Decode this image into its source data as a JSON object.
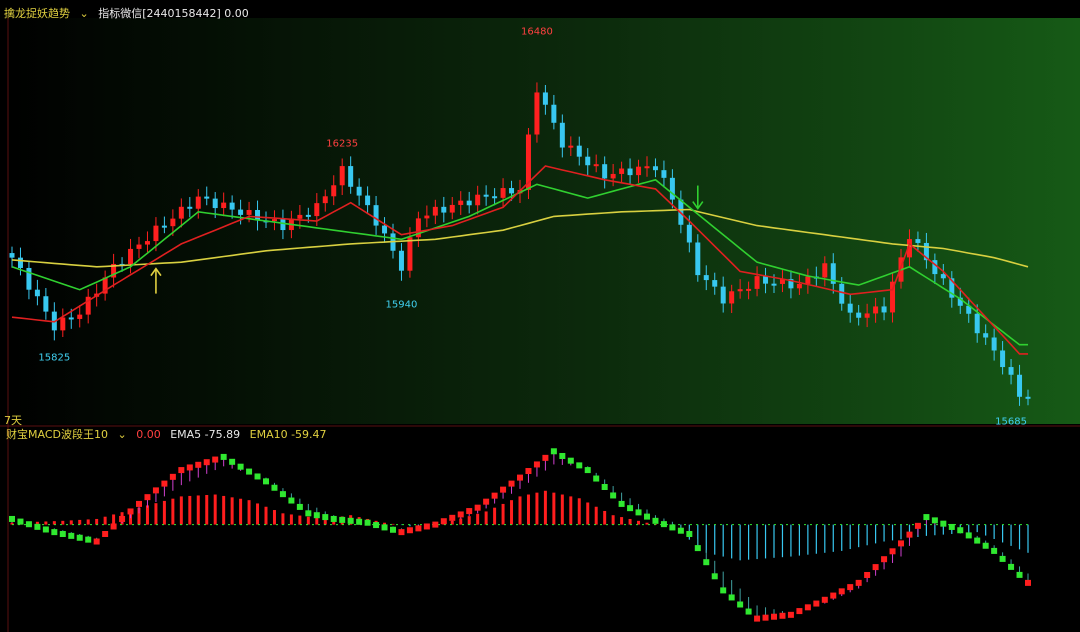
{
  "top_header": {
    "indicator_name": "擒龙捉妖趋势",
    "params_label": "指标微信[2440158442] 0.00"
  },
  "bottom_header": {
    "period_label": "7天",
    "indicator_name": "财宝MACD波段王10",
    "value_label": "0.00",
    "ema5_label": "EMA5 -75.89",
    "ema10_label": "EMA10 -59.47"
  },
  "colors": {
    "up": "#ff2020",
    "down": "#38c8f0",
    "ema_fast": "#e02020",
    "ema_mid": "#30d030",
    "ema_slow": "#d8d040",
    "macd_red": "#ff1e1e",
    "macd_green": "#30e830",
    "text_yellow": "#e0d040",
    "text_red": "#ff4040",
    "text_cyan": "#40d0f0"
  },
  "chart_data": [
    {
      "type": "candlestick",
      "title": "",
      "y_range": [
        15660,
        16520
      ],
      "annotations": [
        {
          "text": "16480",
          "index": 62,
          "value": 16480,
          "color": "red"
        },
        {
          "text": "16235",
          "index": 39,
          "value": 16235,
          "color": "red"
        },
        {
          "text": "15940",
          "index": 46,
          "value": 15940,
          "color": "cyan"
        },
        {
          "text": "15825",
          "index": 5,
          "value": 15825,
          "color": "cyan"
        },
        {
          "text": "15685",
          "index": 118,
          "value": 15685,
          "color": "cyan"
        }
      ],
      "arrows": [
        {
          "index": 17,
          "direction": "up",
          "color": "yellow"
        },
        {
          "index": 81,
          "direction": "down",
          "color": "green"
        }
      ],
      "candle_close_path": [
        [
          0,
          16010
        ],
        [
          5,
          15860
        ],
        [
          8,
          15890
        ],
        [
          12,
          15990
        ],
        [
          17,
          16070
        ],
        [
          22,
          16140
        ],
        [
          27,
          16110
        ],
        [
          32,
          16080
        ],
        [
          36,
          16120
        ],
        [
          39,
          16200
        ],
        [
          43,
          16090
        ],
        [
          46,
          15990
        ],
        [
          48,
          16100
        ],
        [
          55,
          16140
        ],
        [
          60,
          16160
        ],
        [
          62,
          16380
        ],
        [
          65,
          16260
        ],
        [
          70,
          16190
        ],
        [
          76,
          16210
        ],
        [
          78,
          16140
        ],
        [
          81,
          15980
        ],
        [
          84,
          15920
        ],
        [
          88,
          15960
        ],
        [
          93,
          15950
        ],
        [
          96,
          15990
        ],
        [
          99,
          15880
        ],
        [
          103,
          15900
        ],
        [
          106,
          16060
        ],
        [
          109,
          15980
        ],
        [
          113,
          15880
        ],
        [
          117,
          15780
        ],
        [
          119,
          15710
        ]
      ],
      "ema_fast_path": [
        [
          0,
          15880
        ],
        [
          5,
          15870
        ],
        [
          12,
          15950
        ],
        [
          20,
          16040
        ],
        [
          28,
          16100
        ],
        [
          36,
          16090
        ],
        [
          40,
          16130
        ],
        [
          46,
          16060
        ],
        [
          52,
          16080
        ],
        [
          58,
          16120
        ],
        [
          63,
          16210
        ],
        [
          70,
          16180
        ],
        [
          76,
          16160
        ],
        [
          80,
          16090
        ],
        [
          86,
          15980
        ],
        [
          92,
          15960
        ],
        [
          99,
          15930
        ],
        [
          104,
          15940
        ],
        [
          106,
          16040
        ],
        [
          110,
          15980
        ],
        [
          119,
          15800
        ]
      ],
      "ema_mid_path": [
        [
          0,
          15990
        ],
        [
          8,
          15940
        ],
        [
          14,
          15990
        ],
        [
          22,
          16110
        ],
        [
          30,
          16090
        ],
        [
          38,
          16070
        ],
        [
          46,
          16050
        ],
        [
          54,
          16100
        ],
        [
          62,
          16170
        ],
        [
          68,
          16140
        ],
        [
          76,
          16180
        ],
        [
          82,
          16090
        ],
        [
          88,
          16000
        ],
        [
          94,
          15970
        ],
        [
          100,
          15950
        ],
        [
          106,
          15990
        ],
        [
          112,
          15920
        ],
        [
          119,
          15820
        ]
      ],
      "ema_slow_path": [
        [
          0,
          16005
        ],
        [
          10,
          15990
        ],
        [
          20,
          16000
        ],
        [
          30,
          16025
        ],
        [
          40,
          16040
        ],
        [
          50,
          16050
        ],
        [
          58,
          16070
        ],
        [
          64,
          16100
        ],
        [
          72,
          16110
        ],
        [
          80,
          16115
        ],
        [
          88,
          16080
        ],
        [
          96,
          16060
        ],
        [
          104,
          16040
        ],
        [
          110,
          16030
        ],
        [
          116,
          16010
        ],
        [
          120,
          15990
        ]
      ]
    },
    {
      "type": "bar",
      "title": "财宝MACD波段王10",
      "y_range": [
        -110,
        90
      ],
      "histogram_path": [
        [
          0,
          2
        ],
        [
          6,
          4
        ],
        [
          10,
          6
        ],
        [
          15,
          18
        ],
        [
          20,
          30
        ],
        [
          24,
          32
        ],
        [
          28,
          26
        ],
        [
          32,
          12
        ],
        [
          37,
          6
        ],
        [
          40,
          10
        ],
        [
          44,
          2
        ],
        [
          48,
          -3
        ],
        [
          52,
          4
        ],
        [
          56,
          14
        ],
        [
          60,
          30
        ],
        [
          63,
          36
        ],
        [
          67,
          28
        ],
        [
          71,
          10
        ],
        [
          75,
          2
        ],
        [
          78,
          -2
        ],
        [
          82,
          -30
        ],
        [
          86,
          -38
        ],
        [
          92,
          -34
        ],
        [
          98,
          -28
        ],
        [
          103,
          -18
        ],
        [
          108,
          -12
        ],
        [
          114,
          -8
        ],
        [
          120,
          -30
        ]
      ],
      "ema5_path": [
        [
          0,
          6
        ],
        [
          5,
          -8
        ],
        [
          10,
          -18
        ],
        [
          15,
          22
        ],
        [
          20,
          58
        ],
        [
          25,
          72
        ],
        [
          30,
          46
        ],
        [
          35,
          12
        ],
        [
          38,
          6
        ],
        [
          42,
          2
        ],
        [
          46,
          -8
        ],
        [
          50,
          0
        ],
        [
          55,
          18
        ],
        [
          60,
          50
        ],
        [
          64,
          78
        ],
        [
          68,
          58
        ],
        [
          72,
          22
        ],
        [
          76,
          4
        ],
        [
          80,
          -10
        ],
        [
          84,
          -70
        ],
        [
          88,
          -100
        ],
        [
          92,
          -96
        ],
        [
          96,
          -80
        ],
        [
          100,
          -62
        ],
        [
          105,
          -20
        ],
        [
          108,
          8
        ],
        [
          112,
          -6
        ],
        [
          116,
          -28
        ],
        [
          120,
          -62
        ]
      ],
      "ema10_path": [
        [
          0,
          2
        ],
        [
          5,
          -4
        ],
        [
          10,
          -14
        ],
        [
          15,
          12
        ],
        [
          20,
          42
        ],
        [
          25,
          62
        ],
        [
          30,
          50
        ],
        [
          35,
          22
        ],
        [
          38,
          10
        ],
        [
          42,
          4
        ],
        [
          46,
          -4
        ],
        [
          50,
          -2
        ],
        [
          55,
          12
        ],
        [
          60,
          38
        ],
        [
          64,
          64
        ],
        [
          68,
          62
        ],
        [
          72,
          34
        ],
        [
          76,
          10
        ],
        [
          80,
          -4
        ],
        [
          84,
          -50
        ],
        [
          88,
          -86
        ],
        [
          92,
          -94
        ],
        [
          96,
          -84
        ],
        [
          100,
          -68
        ],
        [
          105,
          -34
        ],
        [
          108,
          0
        ],
        [
          112,
          -2
        ],
        [
          116,
          -22
        ],
        [
          120,
          -52
        ]
      ]
    }
  ]
}
